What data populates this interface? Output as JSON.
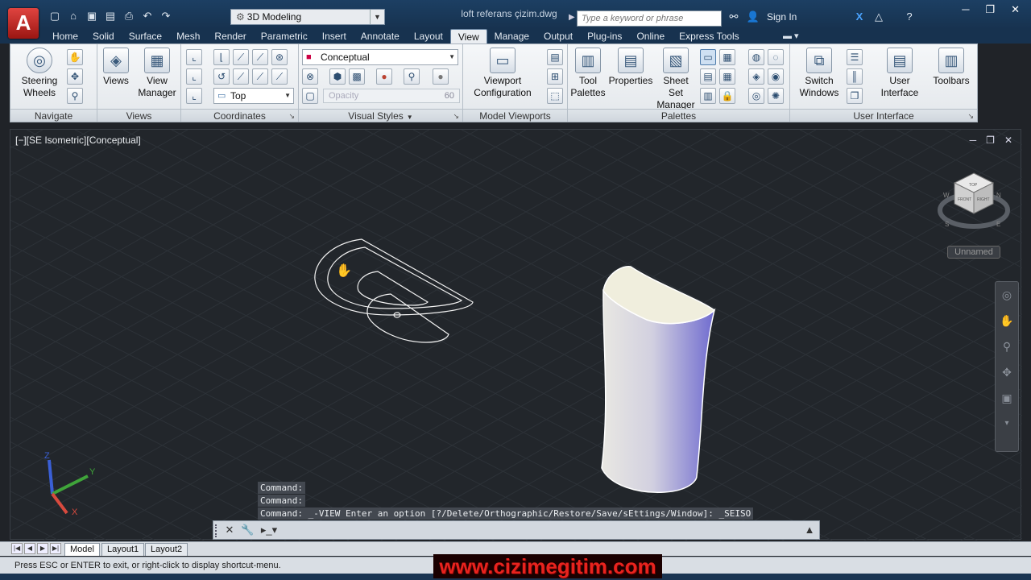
{
  "app": {
    "logo_letter": "A",
    "document_title": "loft referans çizim.dwg",
    "workspace": "3D Modeling",
    "search_placeholder": "Type a keyword or phrase",
    "sign_in": "Sign In"
  },
  "menu_tabs": [
    "Home",
    "Solid",
    "Surface",
    "Mesh",
    "Render",
    "Parametric",
    "Insert",
    "Annotate",
    "Layout",
    "View",
    "Manage",
    "Output",
    "Plug-ins",
    "Online",
    "Express Tools"
  ],
  "active_tab": "View",
  "ribbon": {
    "navigate": {
      "title": "Navigate",
      "steering_wheels": "Steering\nWheels"
    },
    "views": {
      "title": "Views",
      "views_btn": "Views",
      "view_manager": "View\nManager"
    },
    "coordinates": {
      "title": "Coordinates",
      "ucs_combo": "Top"
    },
    "visual_styles": {
      "title": "Visual Styles",
      "style_combo": "Conceptual",
      "opacity_label": "Opacity",
      "opacity_value": "60"
    },
    "model_viewports": {
      "title": "Model Viewports",
      "viewport_config": "Viewport\nConfiguration"
    },
    "palettes": {
      "title": "Palettes",
      "tool_palettes": "Tool\nPalettes",
      "properties": "Properties",
      "sheet_set": "Sheet Set\nManager"
    },
    "user_interface": {
      "title": "User Interface",
      "switch_windows": "Switch\nWindows",
      "user_interface": "User\nInterface",
      "toolbars": "Toolbars"
    }
  },
  "viewport": {
    "label": "[−][SE Isometric][Conceptual]",
    "unnamed": "Unnamed",
    "viewcube_faces": {
      "top": "TOP",
      "front": "FRONT",
      "right": "RIGHT"
    },
    "compass": {
      "n": "N",
      "s": "S",
      "e": "E",
      "w": "W"
    },
    "ucs": {
      "x": "X",
      "y": "Y",
      "z": "Z"
    }
  },
  "command": {
    "history": [
      "Command:",
      "Command:",
      "Command:  _-VIEW Enter an option [?/Delete/Orthographic/Restore/Save/sEttings/Window]: _SEISO"
    ]
  },
  "layout_tabs": [
    "Model",
    "Layout1",
    "Layout2"
  ],
  "status_text": "Press ESC or ENTER to exit, or right-click to display shortcut-menu.",
  "watermark": "www.cizimegitim.com",
  "colors": {
    "accent": "#1c3f63",
    "logo": "#d63a36",
    "watermark": "#e8231e"
  }
}
